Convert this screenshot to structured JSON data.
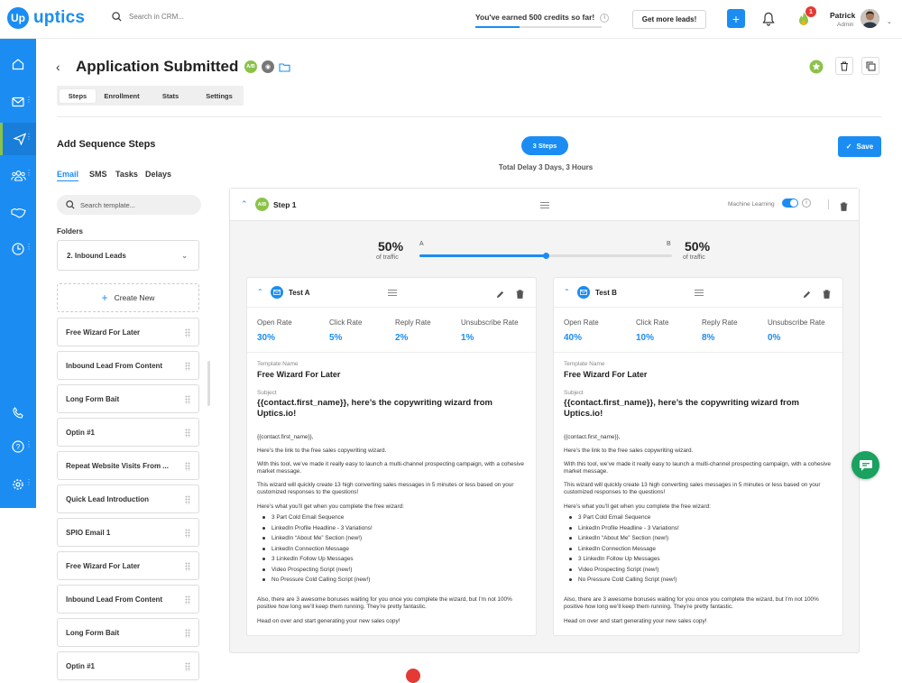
{
  "app": {
    "logo_letter": "Up",
    "logo_text": "uptics"
  },
  "topbar": {
    "search_placeholder": "Search in CRM...",
    "credits_text": "You've earned 500 credits so far!",
    "credits_info": "i",
    "credits_progress_percent": 35,
    "get_leads_label": "Get more leads!",
    "plus_label": "+",
    "fire_badge_count": "1",
    "user_name": "Patrick",
    "user_role": "Admin"
  },
  "sidebar": {
    "items": [
      "home-icon",
      "mail-icon",
      "send-icon",
      "contacts-icon",
      "handshake-icon",
      "analytics-icon",
      "phone-icon",
      "help-icon",
      "settings-icon"
    ]
  },
  "header": {
    "back_label": "‹",
    "title": "Application Submitted",
    "ab_label": "A/B",
    "tabs": [
      "Steps",
      "Enrollment",
      "Stats",
      "Settings"
    ]
  },
  "left": {
    "title": "Add Sequence Steps",
    "subtabs": [
      "Email",
      "SMS",
      "Tasks",
      "Delays"
    ],
    "search_placeholder": "Search template...",
    "folders_label": "Folders",
    "folder_selected": "2. Inbound Leads",
    "create_new_label": "Create New",
    "templates": [
      "Free Wizard For Later",
      "Inbound Lead From Content",
      "Long Form Bait",
      "Optin #1",
      "Repeat Website Visits From ...",
      "Quick Lead Introduction",
      "SPIO Email 1",
      "Free Wizard For Later",
      "Inbound Lead From Content",
      "Long Form Bait",
      "Optin #1"
    ]
  },
  "center": {
    "steps_pill": "3 Steps",
    "total_delay": "Total Delay 3 Days, 3 Hours",
    "save_label": "Save"
  },
  "step": {
    "ab_label": "A/B",
    "title": "Step 1",
    "ml_label": "Machine Learning",
    "ml_on": true,
    "split": {
      "a_percent": "50%",
      "a_sub": "of traffic",
      "a_letter": "A",
      "b_percent": "50%",
      "b_sub": "of traffic",
      "b_letter": "B",
      "slider_fraction": 0.5
    }
  },
  "tests": [
    {
      "title": "Test A",
      "stats": [
        {
          "label": "Open Rate",
          "value": "30%"
        },
        {
          "label": "Click Rate",
          "value": "5%"
        },
        {
          "label": "Reply Rate",
          "value": "2%"
        },
        {
          "label": "Unsubscribe Rate",
          "value": "1%"
        }
      ]
    },
    {
      "title": "Test B",
      "stats": [
        {
          "label": "Open Rate",
          "value": "40%"
        },
        {
          "label": "Click Rate",
          "value": "10%"
        },
        {
          "label": "Reply Rate",
          "value": "8%"
        },
        {
          "label": "Unsubscribe Rate",
          "value": "0%"
        }
      ]
    }
  ],
  "email": {
    "template_label": "Template Name",
    "template_name": "Free Wizard For Later",
    "subject_label": "Subject",
    "subject": "{{contact.first_name}}, here’s the copywriting wizard from Uptics.io!",
    "greeting": "{{contact.first_name}},",
    "p1": "Here’s the link to the free sales copywriting wizard.",
    "p2": "With this tool, we’ve made it really easy to launch a multi-channel prospecting campaign, with a cohesive market message.",
    "p3": "This wizard will quickly create 13 high converting sales messages in 5 minutes or less based on your customized responses to the questions!",
    "p4": "Here’s what you’ll get when you complete the free wizard:",
    "bullets": [
      "3 Part Cold Email Sequence",
      "LinkedIn Profile Headline - 3 Variations!",
      "LinkedIn “About Me” Section (new!)",
      "LinkedIn Connection Message",
      "3 LinkedIn Follow Up Messages",
      "Video Prospecting Script (new!)",
      "No Pressure Cold Calling Script (new!)"
    ],
    "p5": "Also, there are 3 awesome bonuses waiting for you once you complete the wizard, but I’m not 100% positive how long we’ll keep them running. They’re pretty fantastic.",
    "p6": "Head on over and start generating your new sales copy!"
  },
  "colors": {
    "brand": "#1b8df2",
    "ab_green": "#8bc34a",
    "chat": "#1aa260"
  }
}
